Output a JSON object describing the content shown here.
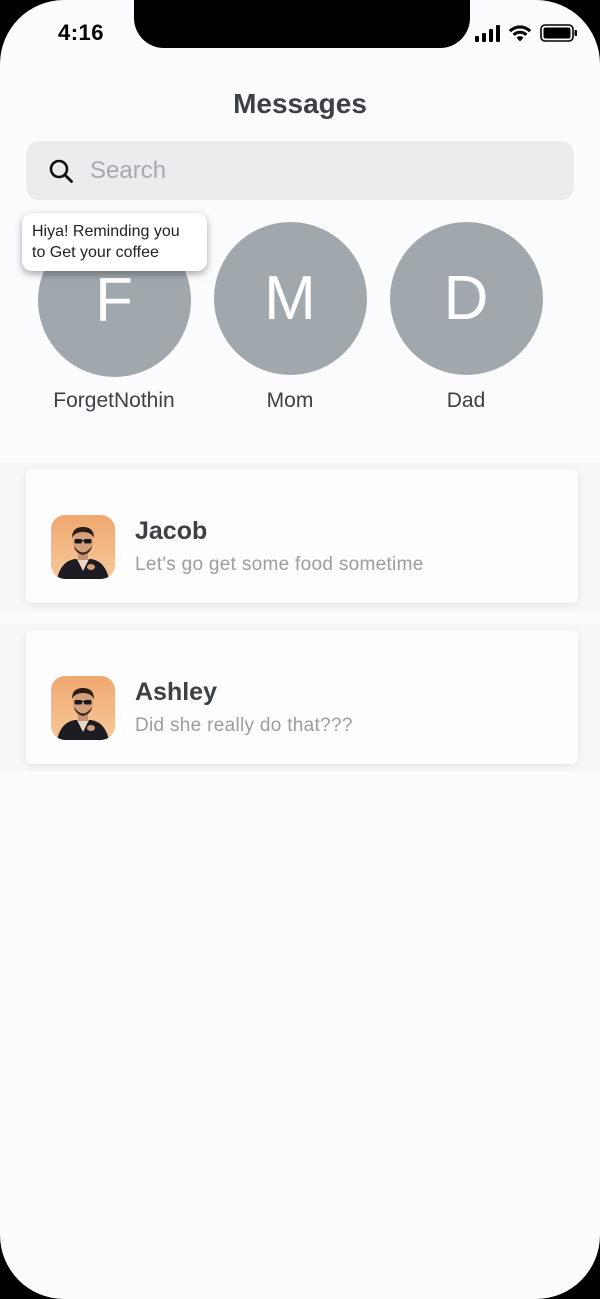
{
  "status_bar": {
    "time": "4:16"
  },
  "header": {
    "title": "Messages"
  },
  "search": {
    "placeholder": "Search",
    "value": ""
  },
  "contacts": [
    {
      "initial": "F",
      "name": "ForgetNothin"
    },
    {
      "initial": "M",
      "name": "Mom"
    },
    {
      "initial": "D",
      "name": "Dad"
    }
  ],
  "reminder": {
    "text_line1": "Hiya! Reminding you",
    "text_line2": "to Get your coffee"
  },
  "conversations": [
    {
      "name": "Jacob",
      "preview": "Let's go get some food sometime",
      "avatar": "profile-photo"
    },
    {
      "name": "Ashley",
      "preview": "Did she really do that???",
      "avatar": "profile-photo"
    }
  ],
  "colors": {
    "background": "#fcfbfd",
    "avatar_gray": "#a0a8ae",
    "text_dark": "#3d4047",
    "text_muted": "#9a9da3",
    "search_bg": "#ececee"
  }
}
